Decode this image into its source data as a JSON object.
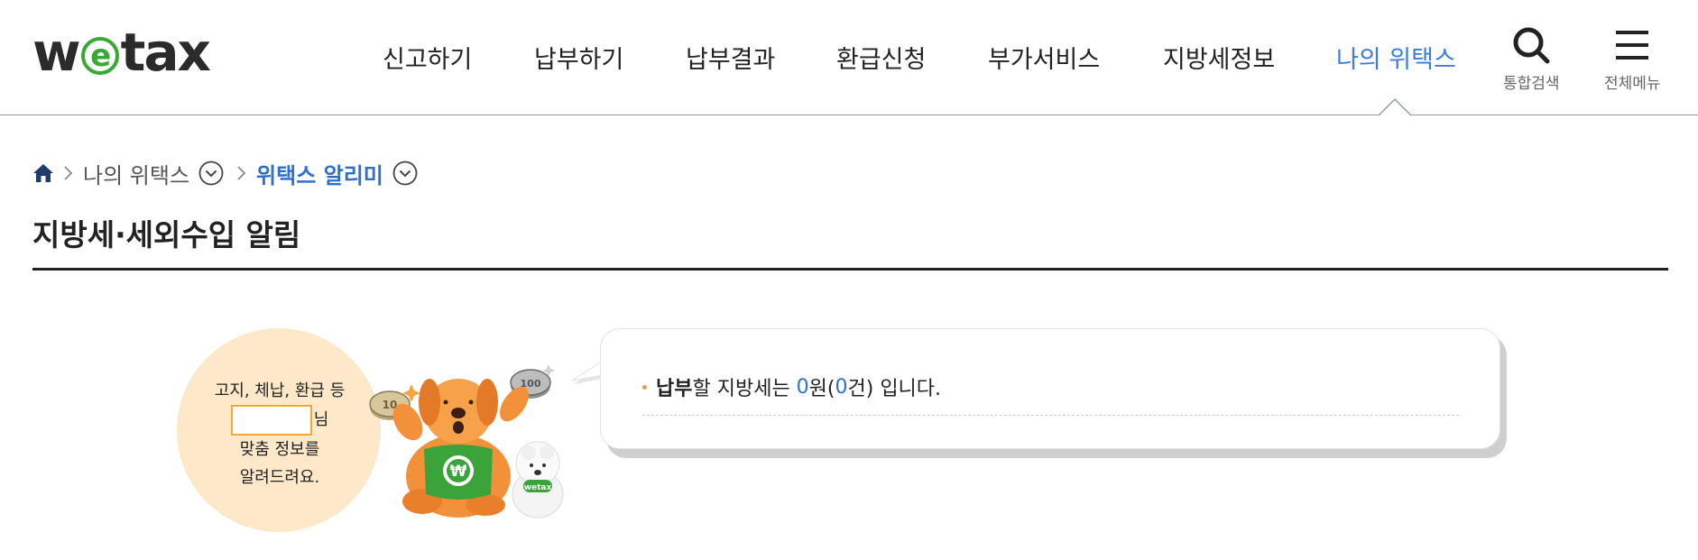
{
  "header": {
    "logo": {
      "pre": "w",
      "e": "e",
      "post": "tax"
    },
    "nav": [
      "신고하기",
      "납부하기",
      "납부결과",
      "환급신청",
      "부가서비스",
      "지방세정보",
      "나의 위택스"
    ],
    "active_nav": "나의 위택스",
    "search_label": "통합검색",
    "menu_label": "전체메뉴"
  },
  "breadcrumb": {
    "home_icon": "home-icon",
    "items": [
      "나의 위택스",
      "위택스 알리미"
    ]
  },
  "page_title": "지방세·세외수입 알림",
  "greeting": {
    "line1": "고지, 체납, 환급 등",
    "name_suffix": "님",
    "line3": "맞춤 정보를",
    "line4": "알려드려요."
  },
  "alert": {
    "bold": "납부",
    "text1": "할 지방세는 ",
    "amount": "0",
    "text2": "원(",
    "count": "0",
    "text3": "건) 입니다."
  },
  "colors": {
    "accent": "#2f6fd0",
    "brand_green": "#38a935",
    "greeting_bg": "#fde9c9",
    "name_box_border": "#f3a82f"
  },
  "mascot_badge": "wetax"
}
